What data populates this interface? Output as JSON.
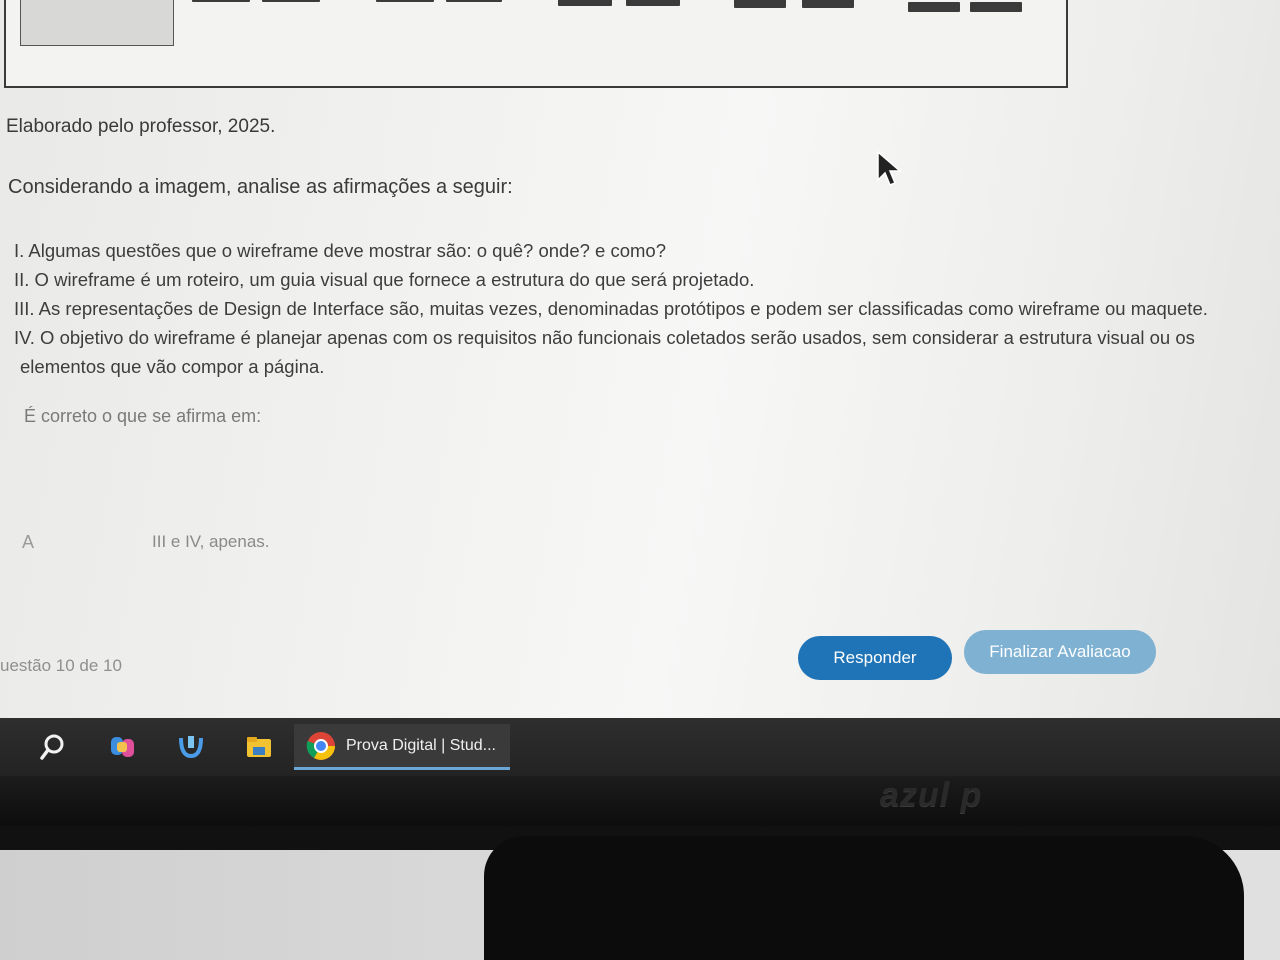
{
  "caption": "Elaborado pelo professor, 2025.",
  "intro": "Considerando a imagem, analise as afirmações a seguir:",
  "statements": [
    "I. Algumas questões que o wireframe deve mostrar são: o quê? onde? e como?",
    "II. O wireframe é um roteiro, um guia visual que fornece a estrutura do que será projetado.",
    "III. As representações de Design de Interface são, muitas vezes, denominadas protótipos e podem ser classificadas como wireframe ou maquete.",
    "IV. O objetivo do wireframe é planejar apenas com os requisitos não funcionais coletados serão usados, sem considerar a estrutura visual ou os",
    "elementos que vão compor a página."
  ],
  "prompt": "É correto o que se afirma em:",
  "option": {
    "letter": "A",
    "text": "III e IV, apenas."
  },
  "counter": "uestão 10 de 10",
  "buttons": {
    "responder": "Responder",
    "finalizar": "Finalizar Avaliacao"
  },
  "taskbar": {
    "active_app_label": "Prova Digital | Stud...",
    "icons": [
      "search-icon",
      "copilot-icon",
      "app-icon",
      "file-explorer-icon",
      "chrome-icon"
    ]
  },
  "monitor_brand": "azul p",
  "colors": {
    "primary_button": "#1f73b7",
    "secondary_button": "#7fb1d3"
  }
}
